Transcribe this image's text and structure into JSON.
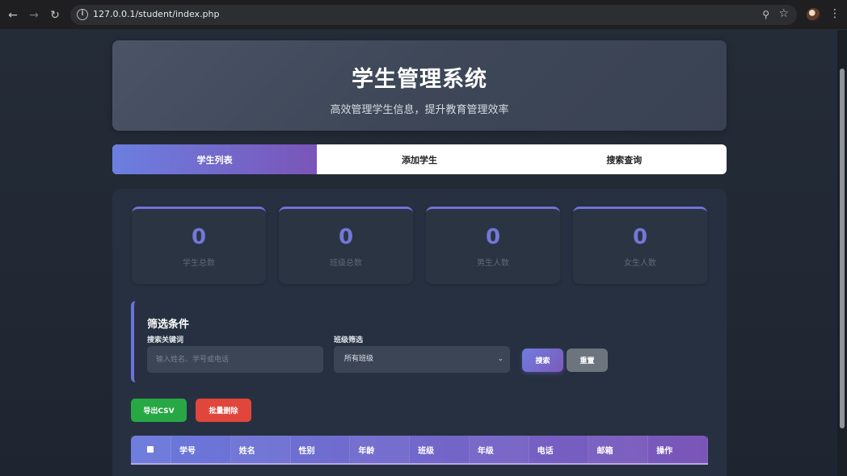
{
  "browser": {
    "url": "127.0.0.1/student/index.php"
  },
  "header": {
    "title": "学生管理系统",
    "subtitle": "高效管理学生信息，提升教育管理效率"
  },
  "tabs": [
    {
      "label": "学生列表",
      "active": true
    },
    {
      "label": "添加学生",
      "active": false
    },
    {
      "label": "搜索查询",
      "active": false
    }
  ],
  "stats": [
    {
      "value": "0",
      "label": "学生总数"
    },
    {
      "value": "0",
      "label": "班级总数"
    },
    {
      "value": "0",
      "label": "男生人数"
    },
    {
      "value": "0",
      "label": "女生人数"
    }
  ],
  "filter": {
    "title": "筛选条件",
    "keyword_label": "搜索关键词",
    "keyword_placeholder": "输入姓名、学号或电话",
    "class_label": "班级筛选",
    "class_selected": "所有班级",
    "search_button": "搜索",
    "reset_button": "重置"
  },
  "actions": {
    "export_button": "导出CSV",
    "bulk_delete_button": "批量删除"
  },
  "table": {
    "columns": [
      "学号",
      "姓名",
      "性别",
      "年龄",
      "班级",
      "年级",
      "电话",
      "邮箱",
      "操作"
    ]
  },
  "colors": {
    "accent_start": "#6b7fe0",
    "accent_end": "#7a55b8",
    "export_green": "#28a745",
    "delete_red": "#e0463b"
  }
}
